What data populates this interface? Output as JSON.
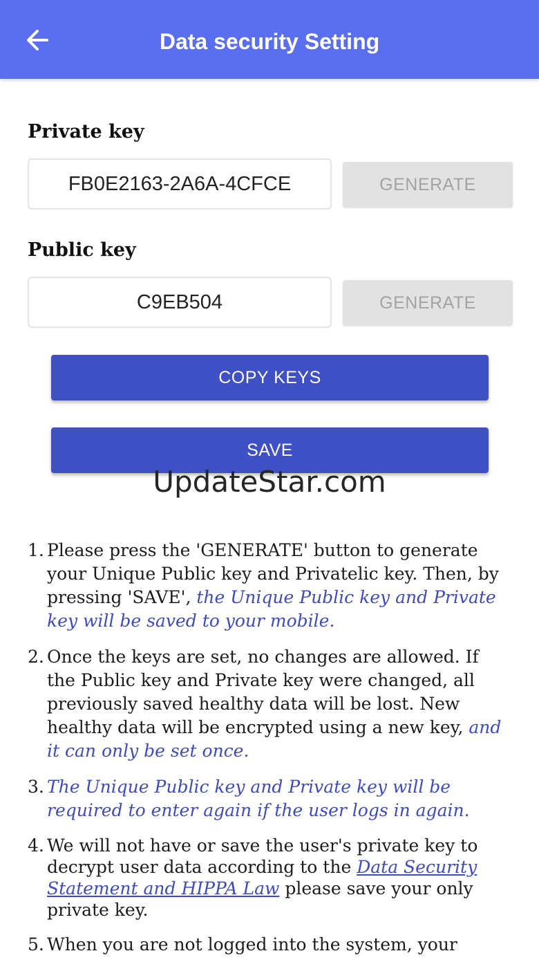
{
  "app_bar": {
    "title": "Data security Setting",
    "back_icon": "arrow-left-icon",
    "background": "#5a6ef0"
  },
  "private_key": {
    "label": "Private key",
    "value": "FB0E2163-2A6A-4CFCE",
    "generate_label": "GENERATE"
  },
  "public_key": {
    "label": "Public key",
    "value": "C9EB504",
    "generate_label": "GENERATE"
  },
  "copy_keys_label": "COPY KEYS",
  "save_label": "SAVE",
  "watermark": "UpdateStar.com",
  "colors": {
    "primary_button": "#3f4fc4",
    "disabled_button": "#e2e2e2",
    "emphasis_text": "#3e4bb8"
  },
  "notes": [
    {
      "number": "1.",
      "text": "Please press the 'GENERATE' button to generate your Unique Public key and Privatelic key. Then, by pressing 'SAVE',",
      "emphasis": "the Unique Public key and Private key will be saved to your mobile."
    },
    {
      "number": "2.",
      "text": "Once the keys are set, no changes are allowed. If the Public key and Private key were changed, all previously saved healthy data will be lost. New healthy data will be encrypted using a new key,",
      "emphasis": "and it can only be set once."
    },
    {
      "number": "3.",
      "emphasis": "The Unique Public key and Private key will be required to enter again if the user logs in again."
    },
    {
      "number": "4.",
      "text_before": "We will not have or save the user's private key to decrypt user data according to the",
      "link": "Data Security Statement and HIPPA Law",
      "text_after": "please save your only private key."
    },
    {
      "number": "5.",
      "text": "When you are not logged into the system, your"
    }
  ]
}
